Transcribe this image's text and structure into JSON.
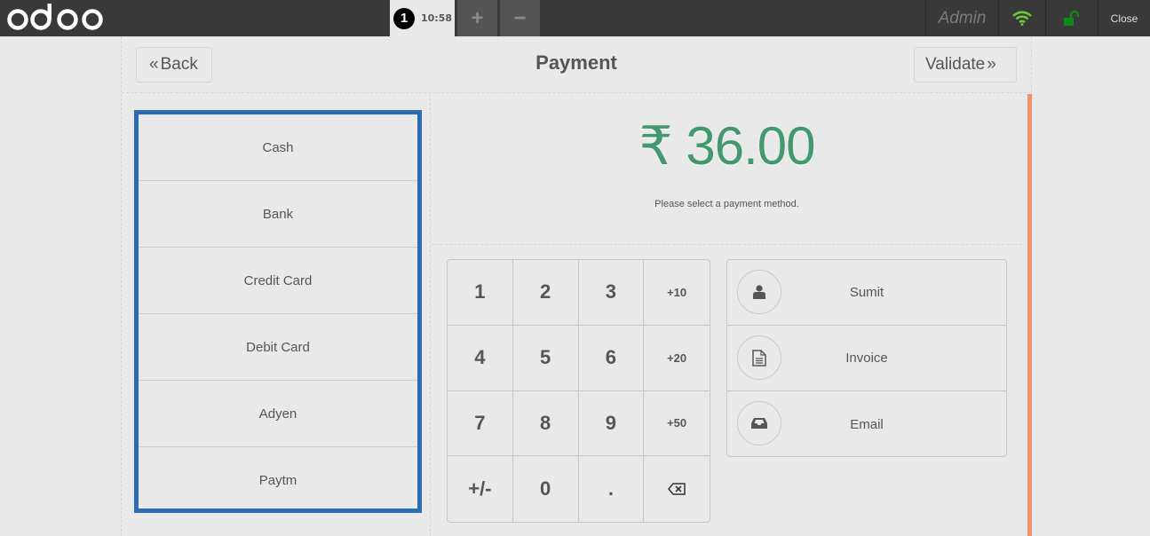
{
  "topbar": {
    "logo": "odoo",
    "order_number": "1",
    "order_time": "10:58",
    "add_tab_label": "+",
    "remove_tab_label": "−",
    "user": "Admin",
    "close_label": "Close",
    "icons": {
      "wifi": "wifi-icon",
      "lock": "unlock-icon"
    },
    "colors": {
      "wifi": "#6ec73a",
      "lock": "#0a8c19"
    }
  },
  "header": {
    "back_label": "Back",
    "back_icon": "«",
    "title": "Payment",
    "validate_label": "Validate",
    "validate_icon": "»"
  },
  "payment_methods": [
    "Cash",
    "Bank",
    "Credit Card",
    "Debit Card",
    "Adyen",
    "Paytm"
  ],
  "due": {
    "amount": "₹ 36.00",
    "hint": "Please select a payment method.",
    "amount_color": "#43996d"
  },
  "numpad": {
    "keys": [
      "1",
      "2",
      "3",
      "+10",
      "4",
      "5",
      "6",
      "+20",
      "7",
      "8",
      "9",
      "+50",
      "+/-",
      "0",
      ".",
      "⌫"
    ]
  },
  "actions": [
    {
      "label": "Sumit",
      "icon": "user-icon"
    },
    {
      "label": "Invoice",
      "icon": "file-text-icon"
    },
    {
      "label": "Email",
      "icon": "inbox-icon"
    }
  ],
  "colors": {
    "selected_border": "#2b6cb3",
    "accent_bar": "#f0916a"
  }
}
